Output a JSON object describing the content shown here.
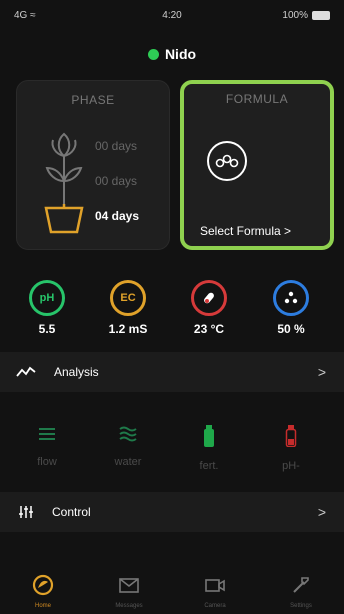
{
  "status_bar": {
    "signal": "4G",
    "time": "4:20",
    "battery": "100%"
  },
  "header": {
    "title": "Nido",
    "status_color": "#2ecc55"
  },
  "phase_card": {
    "title": "PHASE",
    "stages": [
      {
        "label": "00 days",
        "state": "inactive"
      },
      {
        "label": "00 days",
        "state": "inactive"
      },
      {
        "label": "04 days",
        "state": "active"
      }
    ]
  },
  "formula_card": {
    "title": "FORMULA",
    "action_label": "Select Formula >",
    "highlight_color": "#8fd14f"
  },
  "sensors": [
    {
      "code": "pH",
      "value": "5.5",
      "color": "#27c46a",
      "icon": "ph-icon"
    },
    {
      "code": "EC",
      "value": "1.2 mS",
      "color": "#e0a22a",
      "icon": "ec-icon"
    },
    {
      "code": "",
      "value": "23 °C",
      "color": "#d63a3a",
      "icon": "thermometer-icon"
    },
    {
      "code": "",
      "value": "50 %",
      "color": "#2d7de0",
      "icon": "humidity-icon"
    }
  ],
  "analysis": {
    "label": "Analysis",
    "chevron": ">"
  },
  "controls": [
    {
      "label": "flow",
      "icon": "flow-icon",
      "color": "#1f7a4a"
    },
    {
      "label": "water",
      "icon": "water-icon",
      "color": "#1f7a4a"
    },
    {
      "label": "fert.",
      "icon": "fertilizer-bottle-icon",
      "color": "#1fa84a"
    },
    {
      "label": "pH-",
      "icon": "ph-minus-bottle-icon",
      "color": "#c62c2c"
    }
  ],
  "control": {
    "label": "Control",
    "chevron": ">"
  },
  "tabs": [
    {
      "label": "Home",
      "icon": "home-icon",
      "active": true
    },
    {
      "label": "Messages",
      "icon": "mail-icon",
      "active": false
    },
    {
      "label": "Camera",
      "icon": "camera-icon",
      "active": false
    },
    {
      "label": "Settings",
      "icon": "tools-icon",
      "active": false
    }
  ]
}
